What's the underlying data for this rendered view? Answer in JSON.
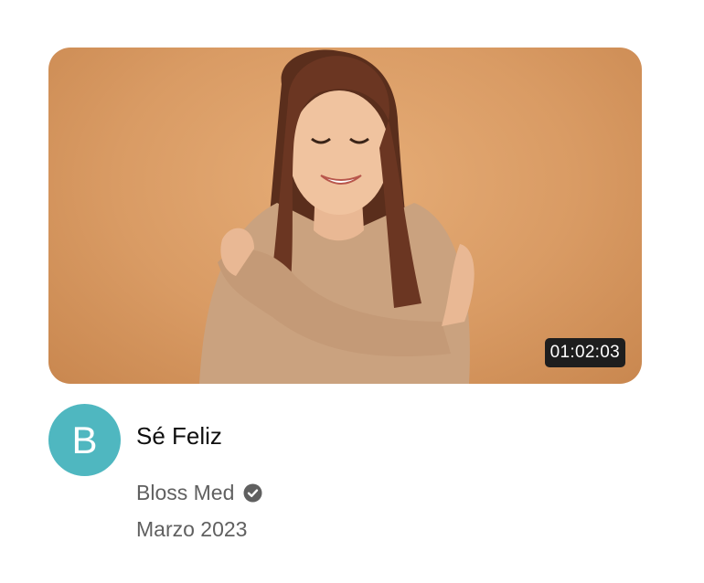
{
  "video": {
    "duration": "01:02:03",
    "title": "Sé Feliz",
    "channel": {
      "avatar_letter": "B",
      "avatar_color": "#4fb7c0",
      "name": "Bloss Med",
      "verified": true,
      "verified_icon": "verified-check-icon"
    },
    "date": "Marzo 2023"
  },
  "colors": {
    "thumbnail_background": "#d99b64",
    "title_text": "#0f0f0f",
    "meta_text": "#606060",
    "duration_badge": "#1e1e1e"
  }
}
